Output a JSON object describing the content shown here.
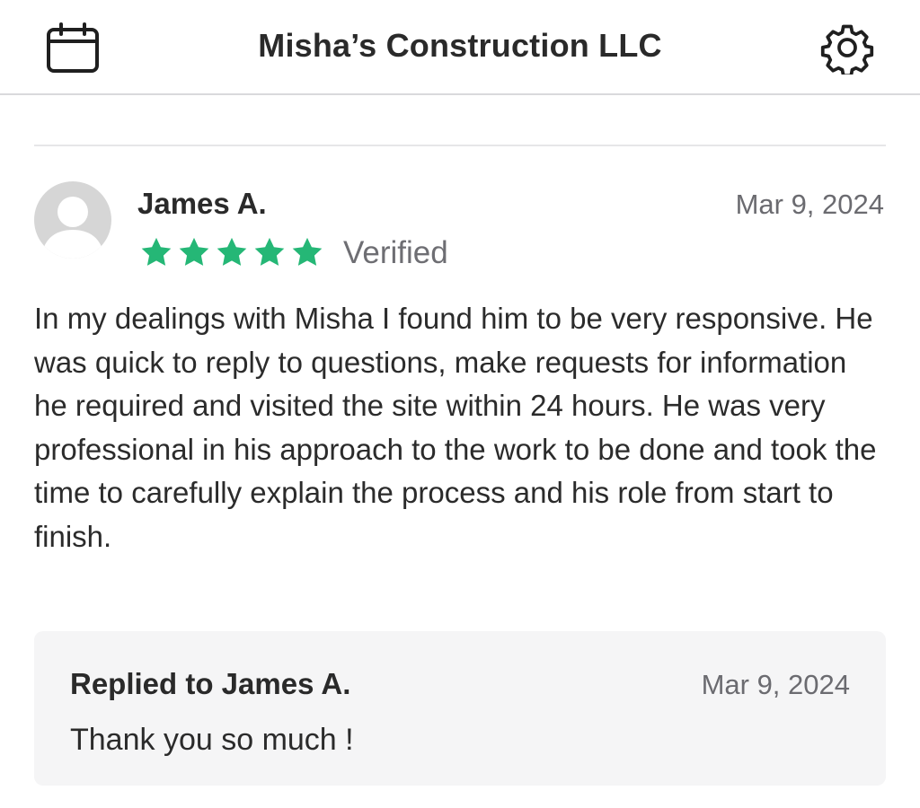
{
  "header": {
    "title": "Misha’s Construction LLC",
    "left_icon": "calendar-icon",
    "right_icon": "gear-icon"
  },
  "review": {
    "reviewer_name": "James A.",
    "date": "Mar 9, 2024",
    "rating": 5,
    "rating_max": 5,
    "verified_label": "Verified",
    "star_color": "#25b776",
    "text": "In my dealings with Misha I found him to be very responsive. He was quick to reply to questions, make requests for information he required and visited the site within 24 hours. He was very professional in his approach to the work to be done and took the time to carefully explain the process and his role from start to finish."
  },
  "reply": {
    "title": "Replied to James A.",
    "date": "Mar 9, 2024",
    "text": "Thank you so much !"
  }
}
